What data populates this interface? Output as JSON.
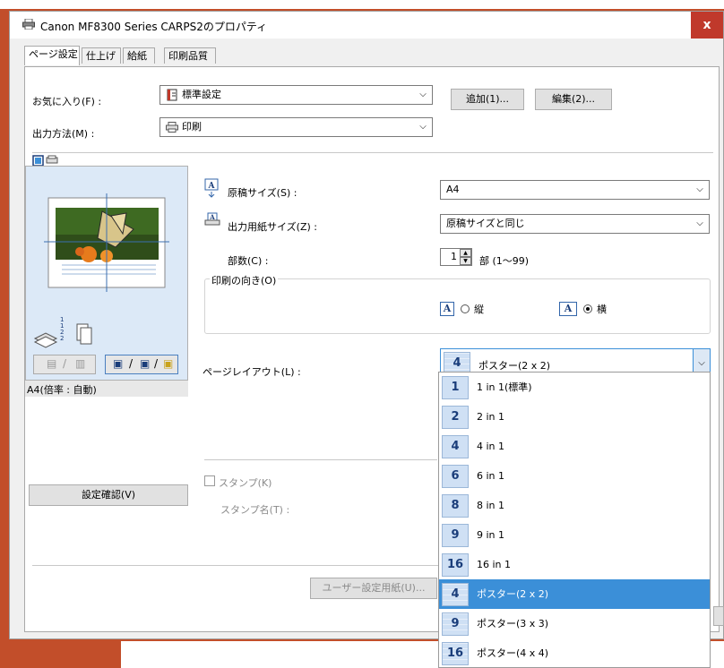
{
  "window": {
    "title": "Canon MF8300 Series CARPS2のプロパティ",
    "close": "x"
  },
  "tabs": [
    "ページ設定",
    "仕上げ",
    "給紙",
    "印刷品質"
  ],
  "favorites": {
    "label": "お気に入り(F) :",
    "value": "標準設定",
    "add_button": "追加(1)...",
    "edit_button": "編集(2)..."
  },
  "output_method": {
    "label": "出力方法(M) :",
    "value": "印刷"
  },
  "preview": {
    "caption": "A4(倍率 : 自動)",
    "confirm_button": "設定確認(V)",
    "page_labels": [
      "1",
      "1",
      "2",
      "2"
    ]
  },
  "page_size": {
    "label": "原稿サイズ(S) :",
    "value": "A4"
  },
  "output_size": {
    "label": "出力用紙サイズ(Z) :",
    "value": "原稿サイズと同じ"
  },
  "copies": {
    "label": "部数(C) :",
    "value": "1",
    "unit": "部 (1～99)"
  },
  "orientation": {
    "label": "印刷の向き(O)",
    "portrait": "縦",
    "landscape": "横",
    "selected": "landscape"
  },
  "page_layout": {
    "label": "ページレイアウト(L) :",
    "value": "ポスター(2 x 2)",
    "value_icon": "4",
    "options": [
      {
        "icon": "1",
        "label": "1 in 1(標準)"
      },
      {
        "icon": "2",
        "label": "2 in 1"
      },
      {
        "icon": "4",
        "label": "4 in 1"
      },
      {
        "icon": "6",
        "label": "6 in 1"
      },
      {
        "icon": "8",
        "label": "8 in 1"
      },
      {
        "icon": "9",
        "label": "9 in 1"
      },
      {
        "icon": "16",
        "label": "16 in 1"
      },
      {
        "icon": "4",
        "label": "ポスター(2 x 2)",
        "selected": true
      },
      {
        "icon": "9",
        "label": "ポスター(3 x 3)"
      },
      {
        "icon": "16",
        "label": "ポスター(4 x 4)"
      }
    ]
  },
  "stamp": {
    "label": "スタンプ(K)",
    "name_label": "スタンプ名(T) :"
  },
  "custom_paper_button": "ユーザー設定用紙(U)...",
  "colors": {
    "accent": "#3b8fd8",
    "close": "#c0392b",
    "background": "#c24e2a"
  }
}
